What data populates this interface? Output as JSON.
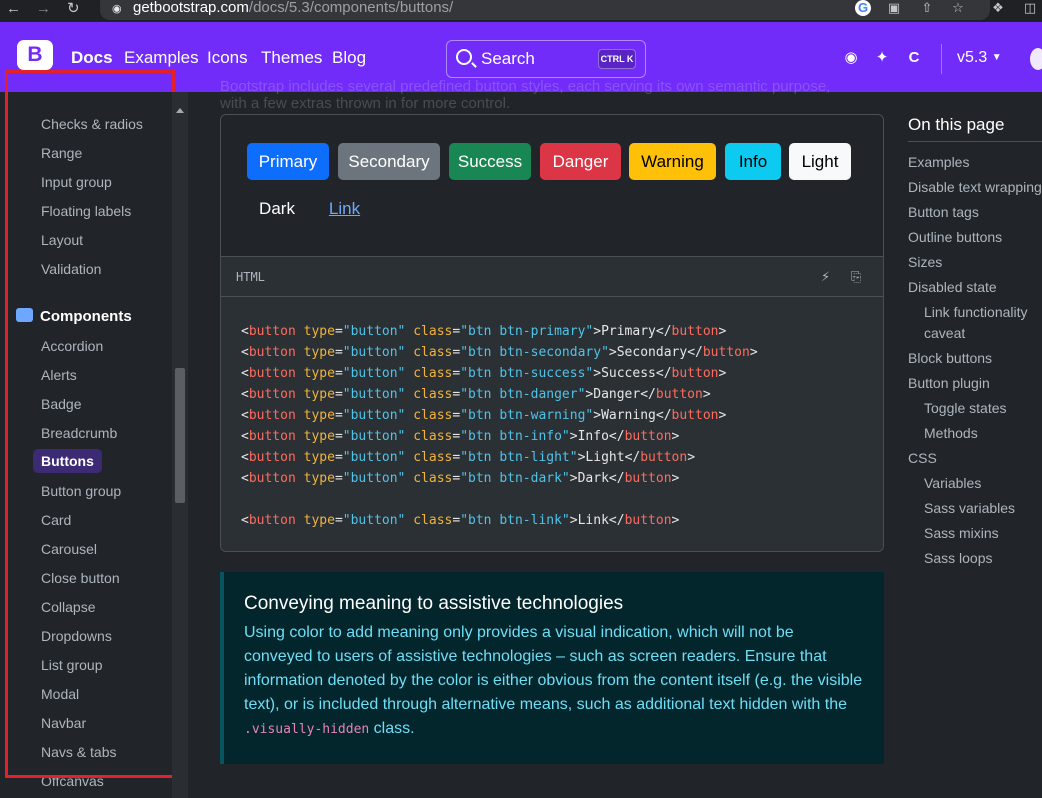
{
  "browser": {
    "url_domain": "getbootstrap.com",
    "url_path": "/docs/5.3/components/buttons/"
  },
  "navbar": {
    "logo": "B",
    "links": [
      "Docs",
      "Examples",
      "Icons",
      "Themes",
      "Blog"
    ],
    "search_placeholder": "Search",
    "search_shortcut": "CTRL K",
    "version": "v5.3",
    "occluded_text": "Bootstrap includes several predefined button styles, each serving its own semantic purpose, with a few extras thrown in for more control."
  },
  "sidebar": {
    "forms_items": [
      "Checks & radios",
      "Range",
      "Input group",
      "Floating labels",
      "Layout",
      "Validation"
    ],
    "components_heading": "Components",
    "components_items": [
      "Accordion",
      "Alerts",
      "Badge",
      "Breadcrumb",
      "Buttons",
      "Button group",
      "Card",
      "Carousel",
      "Close button",
      "Collapse",
      "Dropdowns",
      "List group",
      "Modal",
      "Navbar",
      "Navs & tabs",
      "Offcanvas"
    ],
    "active_item": "Buttons"
  },
  "example": {
    "buttons": [
      {
        "label": "Primary",
        "bg": "#0d6efd",
        "fg": "#ffffff"
      },
      {
        "label": "Secondary",
        "bg": "#6c757d",
        "fg": "#ffffff"
      },
      {
        "label": "Success",
        "bg": "#198754",
        "fg": "#ffffff"
      },
      {
        "label": "Danger",
        "bg": "#dc3545",
        "fg": "#ffffff"
      },
      {
        "label": "Warning",
        "bg": "#ffc107",
        "fg": "#000000"
      },
      {
        "label": "Info",
        "bg": "#0dcaf0",
        "fg": "#000000"
      },
      {
        "label": "Light",
        "bg": "#f8f9fa",
        "fg": "#000000"
      },
      {
        "label": "Dark",
        "bg": "#212529",
        "fg": "#ffffff"
      },
      {
        "label": "Link",
        "bg": "transparent",
        "fg": "#6ea8fe"
      }
    ],
    "code_label": "HTML",
    "code_lines": [
      {
        "cls": "btn btn-primary",
        "text": "Primary"
      },
      {
        "cls": "btn btn-secondary",
        "text": "Secondary"
      },
      {
        "cls": "btn btn-success",
        "text": "Success"
      },
      {
        "cls": "btn btn-danger",
        "text": "Danger"
      },
      {
        "cls": "btn btn-warning",
        "text": "Warning"
      },
      {
        "cls": "btn btn-info",
        "text": "Info"
      },
      {
        "cls": "btn btn-light",
        "text": "Light"
      },
      {
        "cls": "btn btn-dark",
        "text": "Dark"
      },
      {
        "cls": "",
        "text": ""
      },
      {
        "cls": "btn btn-link",
        "text": "Link"
      }
    ]
  },
  "callout": {
    "title": "Conveying meaning to assistive technologies",
    "body": "Using color to add meaning only provides a visual indication, which will not be conveyed to users of assistive technologies – such as screen readers. Ensure that information denoted by the color is either obvious from the content itself (e.g. the visible text), or is included through alternative means, such as additional text hidden with the ",
    "code": ".visually-hidden",
    "tail": " class."
  },
  "toc": {
    "heading": "On this page",
    "items": [
      {
        "label": "Examples",
        "sub": false
      },
      {
        "label": "Disable text wrapping",
        "sub": false
      },
      {
        "label": "Button tags",
        "sub": false
      },
      {
        "label": "Outline buttons",
        "sub": false
      },
      {
        "label": "Sizes",
        "sub": false
      },
      {
        "label": "Disabled state",
        "sub": false
      },
      {
        "label": "Link functionality",
        "sub": true
      },
      {
        "label": "caveat",
        "sub": true
      },
      {
        "label": "Block buttons",
        "sub": false
      },
      {
        "label": "Button plugin",
        "sub": false
      },
      {
        "label": "Toggle states",
        "sub": true
      },
      {
        "label": "Methods",
        "sub": true
      },
      {
        "label": "CSS",
        "sub": false
      },
      {
        "label": "Variables",
        "sub": true
      },
      {
        "label": "Sass variables",
        "sub": true
      },
      {
        "label": "Sass mixins",
        "sub": true
      },
      {
        "label": "Sass loops",
        "sub": true
      }
    ]
  },
  "colors": {
    "brand": "#712cf9",
    "highlight": "#e4212b"
  }
}
